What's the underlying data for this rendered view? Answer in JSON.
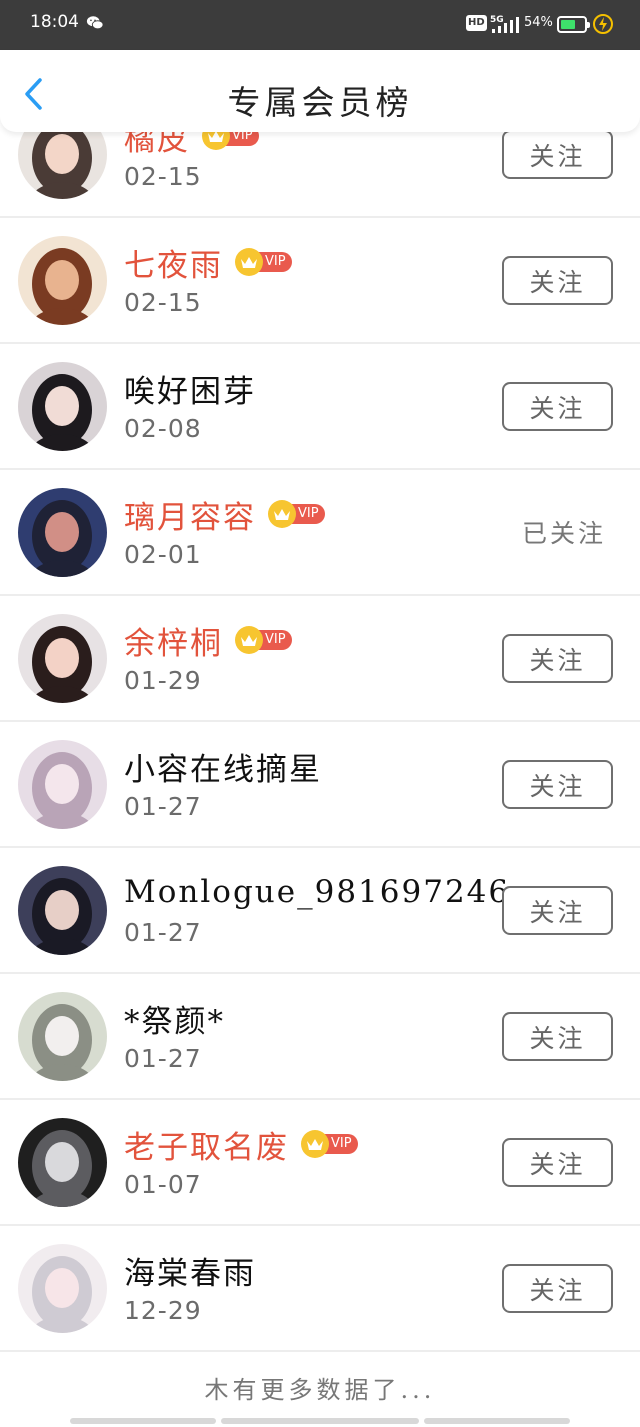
{
  "status_bar": {
    "time": "18:04",
    "hd": "HD",
    "network": "5G",
    "battery_percent": "54%",
    "battery_level": 0.54,
    "icons": [
      "wechat-icon",
      "signal-icon",
      "battery-icon",
      "charging-icon"
    ]
  },
  "header": {
    "title": "专属会员榜",
    "back_icon": "chevron-left-icon"
  },
  "colors": {
    "vip_name": "#e2533c",
    "vip_badge": "#e95a4d",
    "crown": "#f7c530",
    "back_arrow": "#2a9df4",
    "status_bar_bg": "#3c3c3c"
  },
  "vip_label": "VIP",
  "follow_label": "关注",
  "followed_label": "已关注",
  "members": [
    {
      "name": "橘皮",
      "date": "02-15",
      "vip": true,
      "followed": false
    },
    {
      "name": "七夜雨",
      "date": "02-15",
      "vip": true,
      "followed": false
    },
    {
      "name": "唉好困芽",
      "date": "02-08",
      "vip": false,
      "followed": false
    },
    {
      "name": "璃月容容",
      "date": "02-01",
      "vip": true,
      "followed": true
    },
    {
      "name": "余梓桐",
      "date": "01-29",
      "vip": true,
      "followed": false
    },
    {
      "name": "小容在线摘星",
      "date": "01-27",
      "vip": false,
      "followed": false
    },
    {
      "name": "Monlogue_981697246",
      "date": "01-27",
      "vip": false,
      "followed": false
    },
    {
      "name": "*祭颜*",
      "date": "01-27",
      "vip": false,
      "followed": false
    },
    {
      "name": "老子取名废",
      "date": "01-07",
      "vip": true,
      "followed": false
    },
    {
      "name": "海棠春雨",
      "date": "12-29",
      "vip": false,
      "followed": false
    }
  ],
  "footer": "木有更多数据了..."
}
